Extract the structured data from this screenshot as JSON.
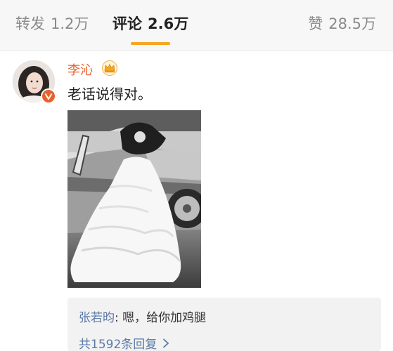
{
  "tabs": {
    "repost": {
      "label": "转发",
      "count": "1.2万"
    },
    "comment": {
      "label": "评论",
      "count": "2.6万"
    },
    "like": {
      "label": "赞",
      "count": "28.5万"
    }
  },
  "comment": {
    "username": "李沁",
    "text": "老话说得对。",
    "badges": [
      "crown-icon",
      "verified-icon"
    ],
    "photo_alt": "black-and-white wedding photo"
  },
  "reply": {
    "username": "张若昀",
    "colon": ":",
    "content": " 嗯，给你加鸡腿",
    "more": "共1592条回复"
  },
  "colors": {
    "accent": "#f5a623",
    "username": "#e8612c",
    "link": "#5b7ba8"
  }
}
